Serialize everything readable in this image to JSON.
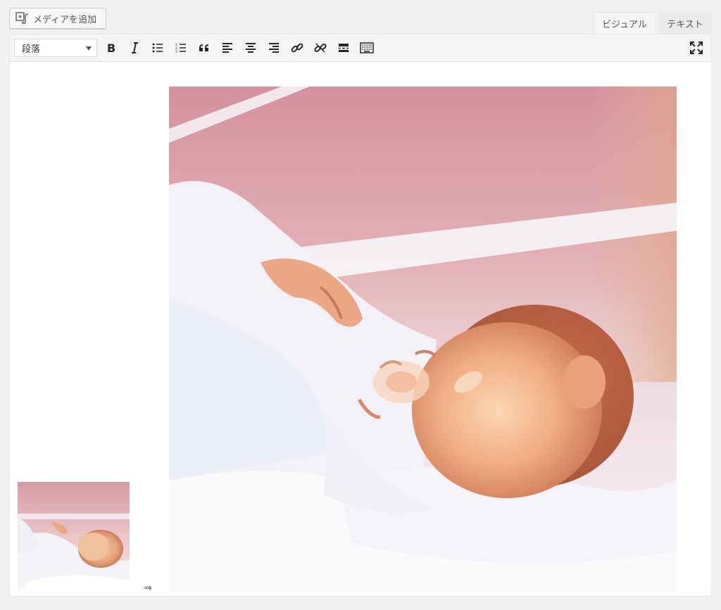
{
  "toolbar_top": {
    "add_media_label": "メディアを追加",
    "tab_visual": "ビジュアル",
    "tab_text": "テキスト"
  },
  "editor_toolbar": {
    "format_select_value": "段落",
    "buttons": [
      {
        "name": "bold",
        "icon": "bold-icon"
      },
      {
        "name": "italic",
        "icon": "italic-icon"
      },
      {
        "name": "bulleted-list",
        "icon": "bulleted-list-icon"
      },
      {
        "name": "numbered-list",
        "icon": "numbered-list-icon"
      },
      {
        "name": "blockquote",
        "icon": "quote-icon"
      },
      {
        "name": "align-left",
        "icon": "align-left-icon"
      },
      {
        "name": "align-center",
        "icon": "align-center-icon"
      },
      {
        "name": "align-right",
        "icon": "align-right-icon"
      },
      {
        "name": "insert-link",
        "icon": "link-icon"
      },
      {
        "name": "remove-link",
        "icon": "unlink-icon"
      },
      {
        "name": "read-more",
        "icon": "read-more-icon"
      },
      {
        "name": "toolbar-toggle",
        "icon": "keyboard-icon"
      }
    ],
    "fullscreen_icon": "fullscreen-icon"
  },
  "content": {
    "arrow_text": "⇒",
    "images": [
      {
        "name": "baby-thumbnail",
        "subject": "newborn baby in hospital bassinet"
      },
      {
        "name": "baby-large",
        "subject": "newborn baby in hospital bassinet"
      }
    ]
  },
  "colors": {
    "page_bg": "#f1f1f1",
    "toolbar_bg": "#f5f5f5",
    "editor_bg": "#ffffff",
    "border": "#e5e5e5"
  }
}
